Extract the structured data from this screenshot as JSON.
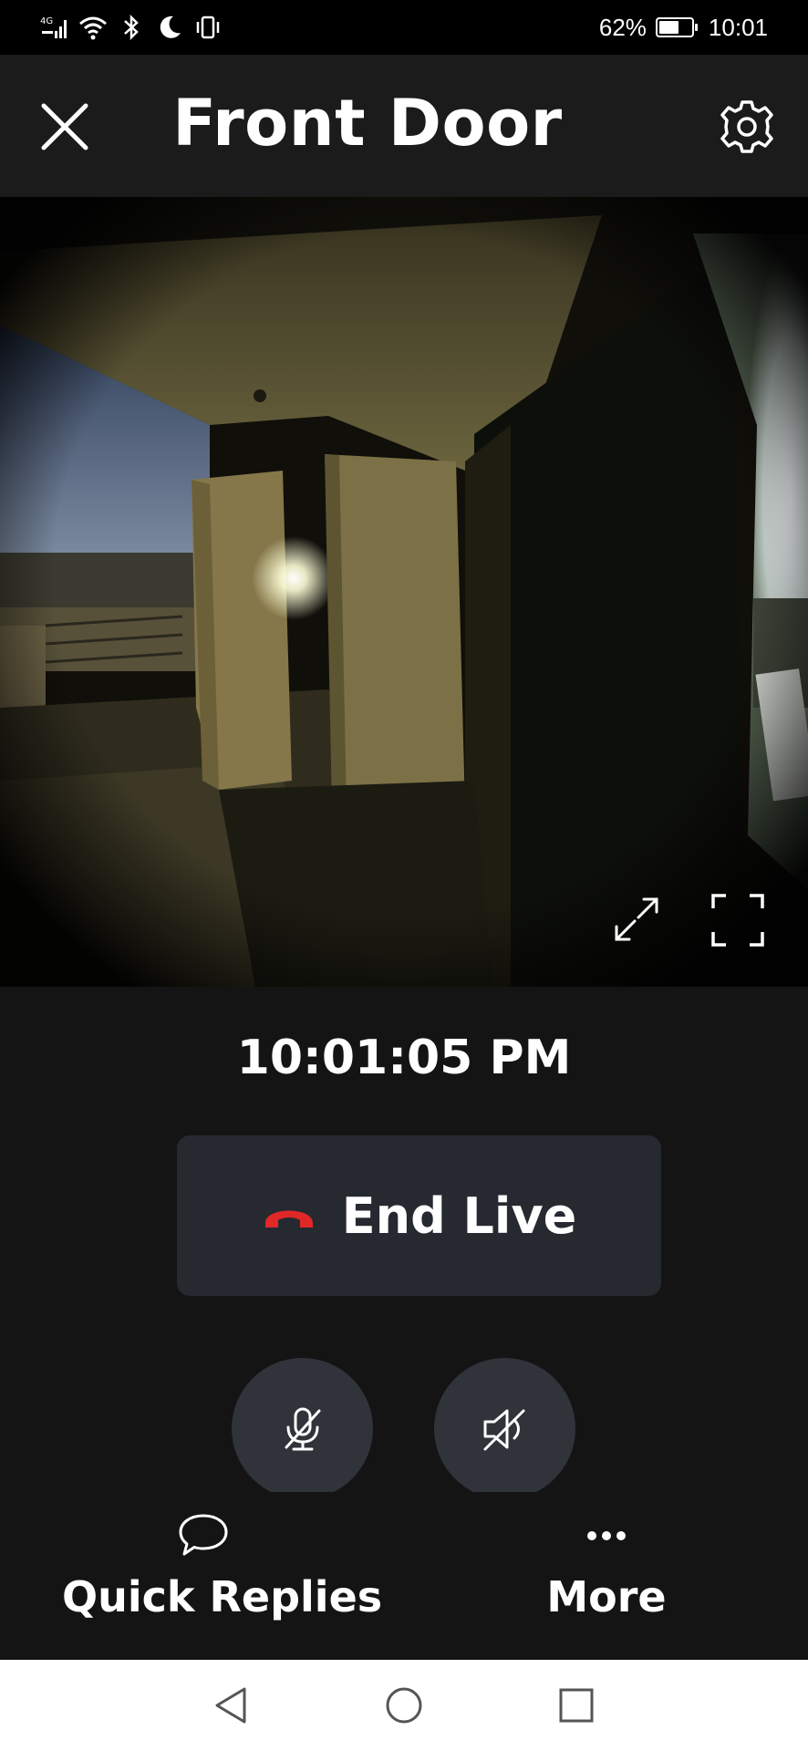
{
  "status_bar": {
    "network": "4G",
    "battery_percent": "62%",
    "battery_level": 0.62,
    "time": "10:01"
  },
  "header": {
    "title": "Front Door",
    "close_icon": "close-icon",
    "settings_icon": "gear-icon"
  },
  "video": {
    "expand_icon": "expand-arrows-icon",
    "fullscreen_icon": "fullscreen-icon"
  },
  "controls": {
    "timestamp": "10:01:05 PM",
    "end_live_label": "End Live",
    "end_live_color": "#e02828",
    "mic_icon": "mic-muted-icon",
    "speaker_icon": "speaker-muted-icon"
  },
  "actions": {
    "quick_replies_label": "Quick Replies",
    "more_label": "More"
  },
  "colors": {
    "background": "#141414",
    "header": "#1b1b1b",
    "button": "#262a30",
    "round_button": "#30333a"
  }
}
